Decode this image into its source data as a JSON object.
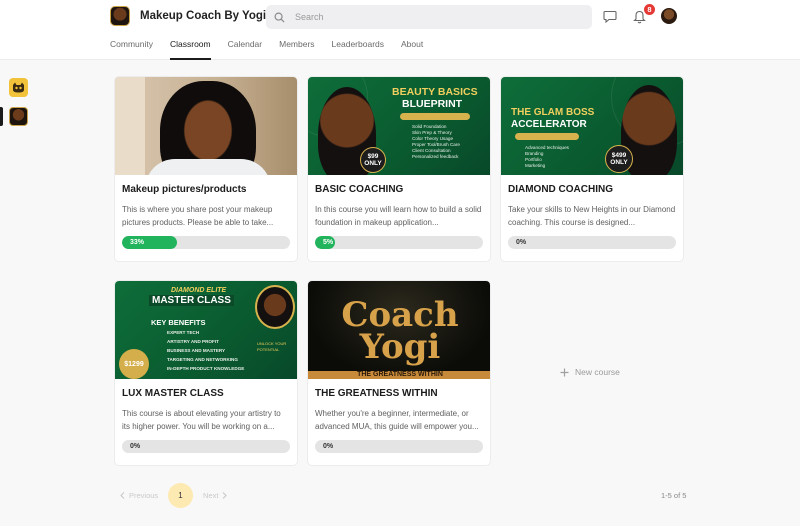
{
  "header": {
    "community_name": "Makeup Coach By Yogi",
    "search_placeholder": "Search",
    "notification_count": "8"
  },
  "tabs": [
    {
      "label": "Community",
      "active": false
    },
    {
      "label": "Classroom",
      "active": true
    },
    {
      "label": "Calendar",
      "active": false
    },
    {
      "label": "Members",
      "active": false
    },
    {
      "label": "Leaderboards",
      "active": false
    },
    {
      "label": "About",
      "active": false
    }
  ],
  "courses": [
    {
      "title": "Makeup pictures/products",
      "description": "This is where you share post your makeup pictures products. Please be able to take...",
      "progress": 33,
      "progress_label": "33%"
    },
    {
      "title": "BASIC COACHING",
      "description": "In this course you will learn how to build a solid foundation in makeup application...",
      "progress": 5,
      "progress_label": "5%",
      "thumb": {
        "line1": "BEAUTY BASICS",
        "line2": "BLUEPRINT",
        "ribbon": "SKILL MASTERY FOUNDATION",
        "price": "$99",
        "price_sub": "ONLY",
        "bullets": [
          "Solid Foundation",
          "Skin Prep & Theory",
          "Color Theory Usage",
          "Proper Tool/Brush Care",
          "Client Consultation",
          "Personalized feedback"
        ]
      }
    },
    {
      "title": "DIAMOND COACHING",
      "description": "Take your skills to New Heights in our Diamond coaching. This course is designed...",
      "progress": 0,
      "progress_label": "0%",
      "thumb": {
        "line1": "THE GLAM BOSS",
        "line2": "ACCELERATOR",
        "ribbon": "LEARN, MASTER, ACCELERATE",
        "price": "$499",
        "price_sub": "ONLY",
        "bullets": [
          "Advanced techniques",
          "Branding",
          "Portfolio",
          "Marketing"
        ]
      }
    },
    {
      "title": "LUX MASTER CLASS",
      "description": "This course is about elevating your artistry to its higher power. You will be working on a...",
      "progress": 0,
      "progress_label": "0%",
      "thumb": {
        "line1": "DIAMOND ELITE",
        "line2": "MASTER CLASS",
        "heading": "KEY BENEFITS",
        "bullets": [
          "EXPERT TECH",
          "ARTISTRY AND PROFIT",
          "BUSINESS AND MASTERY",
          "TARGETING AND NETWORKING",
          "IN-DEPTH PRODUCT KNOWLEDGE"
        ],
        "price": "$1299",
        "tagline": "UNLOCK YOUR POTENTIAL"
      }
    },
    {
      "title": "THE GREATNESS WITHIN",
      "description": "Whether you're a beginner, intermediate, or advanced MUA, this guide will empower you...",
      "progress": 0,
      "progress_label": "0%",
      "thumb": {
        "line1": "Coach",
        "line2": "Yogi",
        "band": "THE GREATNESS WITHIN"
      }
    }
  ],
  "new_course_label": "New course",
  "pagination": {
    "prev_label": "Previous",
    "next_label": "Next",
    "current_page": "1",
    "count_label": "1-5 of 5"
  },
  "colors": {
    "progress_fill": "#21b45c",
    "accent_gold": "#f1cf5e",
    "thumb_green": "#0e6e3a",
    "badge_red": "#e53935",
    "page_highlight": "#fde9b2"
  }
}
